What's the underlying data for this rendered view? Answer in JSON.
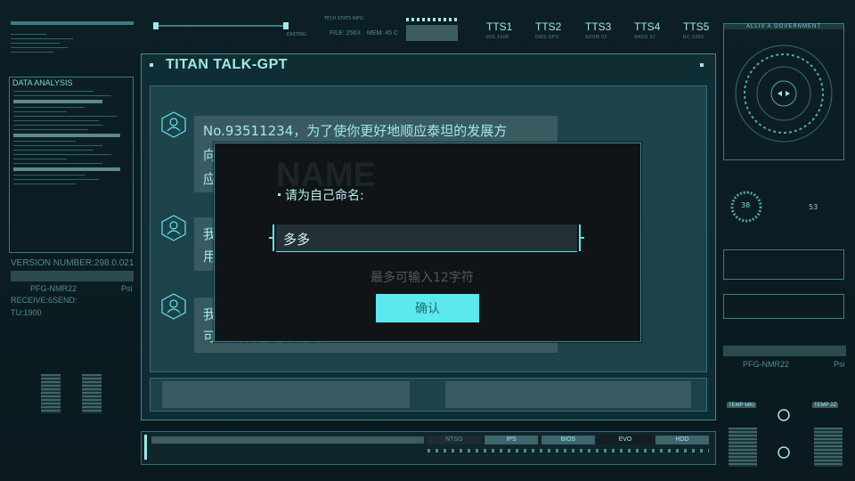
{
  "window": {
    "title": "TITAN TALK-GPT"
  },
  "header_center": {
    "label_small": "TECH STATS INFO",
    "file_label": "FILE: 256X",
    "mem_label": "MEM: 45 C",
    "coord_label": "EASTING"
  },
  "tts_row": [
    {
      "label": "TTS1",
      "sub": "DIG 1008"
    },
    {
      "label": "TTS2",
      "sub": "DMS OPS"
    },
    {
      "label": "TTS3",
      "sub": "SDSM 02"
    },
    {
      "label": "TTS4",
      "sub": "SHDS 07"
    },
    {
      "label": "TTS5",
      "sub": "RC 0290"
    }
  ],
  "left_panel": {
    "data_analysis_title": "DATA ANALYSIS",
    "version": "VERSION NUMBER:298.0.021",
    "pfg": "PFG-NMR22",
    "psi": "Psi",
    "receive": "RECEIVE:6SEND:",
    "tu": "TU:1900"
  },
  "right_panel": {
    "gov_title": "ALLIV A GOVERNMENT",
    "gauge_a": "38",
    "gauge_b": "53",
    "pfg": "PFG-NMR22",
    "psi": "Psi",
    "temp1": "TEMP MKI",
    "temp2": "TEMP 2Z"
  },
  "chat": {
    "messages": [
      {
        "text_line1": "No.93511234，为了使你更好地顺应泰坦的发展方",
        "text_line2": "向",
        "text_line3": "应"
      },
      {
        "text_line1": "我",
        "text_line2": "用"
      },
      {
        "text_line1": "我",
        "text_line2": "可以起名也是不是可。"
      }
    ]
  },
  "modal": {
    "watermark": "NAME",
    "prompt": "请为自己命名:",
    "input_value": "多多",
    "hint": "最多可输入12字符",
    "confirm_label": "确认"
  },
  "bottom_bar": {
    "chips": [
      "NTSG",
      "IPS",
      "BIOS",
      "EVO",
      "HDD"
    ]
  },
  "colors": {
    "accent": "#5ce8ef",
    "panel_bg": "#0f2a30",
    "modal_bg": "#101417",
    "text": "#9fe9ea"
  }
}
